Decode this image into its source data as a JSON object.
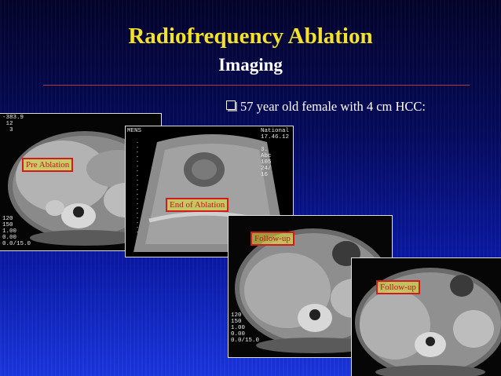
{
  "slide": {
    "title": "Radiofrequency Ablation",
    "subtitle": "Imaging",
    "bullet": "57 year old female with 4 cm HCC:"
  },
  "images": [
    {
      "label": "Pre Ablation",
      "overlay_top": "-383.9\n 12\n  3",
      "overlay_bottom": "120\n150\n1.00\n0.00\n0.0/15.0"
    },
    {
      "label": "End of Ablation",
      "overlay_top": "MENS",
      "overlay_right": "National Ca\n17.46.12 1:\n\n3.\nAbc\n105\n24/\n16"
    },
    {
      "label": "Follow-up",
      "overlay_bottom": "120\n150\n1.00\n0.00\n0.0/15.0"
    },
    {
      "label": "Follow-up"
    }
  ],
  "colors": {
    "title": "#f4e22a",
    "background": "#0a1aa8",
    "label_border": "#d21c1c"
  }
}
